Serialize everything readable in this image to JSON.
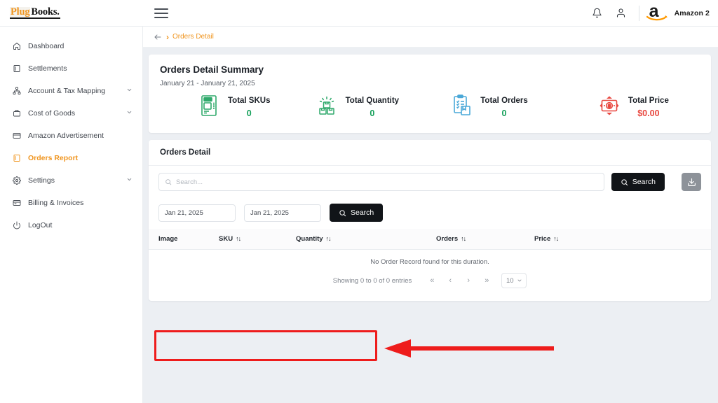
{
  "brand": {
    "logo_plug": "Plug",
    "logo_books": "Books."
  },
  "topbar": {
    "menu_icon": "hamburger-icon",
    "notification_icon": "bell-icon",
    "profile_icon": "user-icon",
    "marketplace_icon": "amazon-logo",
    "marketplace_label": "Amazon 2"
  },
  "sidebar": {
    "items": [
      {
        "label": "Dashboard",
        "icon": "home-icon",
        "active": false,
        "chevron": false
      },
      {
        "label": "Settlements",
        "icon": "book-icon",
        "active": false,
        "chevron": false
      },
      {
        "label": "Account & Tax Mapping",
        "icon": "sitemap-icon",
        "active": false,
        "chevron": true
      },
      {
        "label": "Cost of Goods",
        "icon": "briefcase-icon",
        "active": false,
        "chevron": true
      },
      {
        "label": "Amazon Advertisement",
        "icon": "card-icon",
        "active": false,
        "chevron": false
      },
      {
        "label": "Orders Report",
        "icon": "report-icon",
        "active": true,
        "chevron": false
      },
      {
        "label": "Settings",
        "icon": "gear-icon",
        "active": false,
        "chevron": true
      },
      {
        "label": "Billing & Invoices",
        "icon": "invoice-icon",
        "active": false,
        "chevron": false
      },
      {
        "label": "LogOut",
        "icon": "power-icon",
        "active": false,
        "chevron": false
      }
    ]
  },
  "breadcrumb": {
    "back_icon": "back-arrow-icon",
    "separator": "›",
    "current": "Orders Detail"
  },
  "summary": {
    "title": "Orders Detail Summary",
    "date_range": "January 21 - January 21, 2025",
    "stats": [
      {
        "label": "Total SKUs",
        "value": "0",
        "icon": "sku-document-icon",
        "color": "green"
      },
      {
        "label": "Total Quantity",
        "value": "0",
        "icon": "boxes-stack-icon",
        "color": "green"
      },
      {
        "label": "Total Orders",
        "value": "0",
        "icon": "clipboard-box-icon",
        "color": "green"
      },
      {
        "label": "Total Price",
        "value": "$0.00",
        "icon": "money-bill-icon",
        "color": "red"
      }
    ]
  },
  "orders_panel": {
    "title": "Orders Detail",
    "search_placeholder": "Search...",
    "search_button": "Search",
    "search_icon": "search-icon",
    "download_icon": "download-icon",
    "date_from": "Jan 21, 2025",
    "date_to": "Jan 21, 2025",
    "date_search_button": "Search",
    "columns": [
      {
        "label": "Image",
        "sortable": false
      },
      {
        "label": "SKU",
        "sortable": true
      },
      {
        "label": "Quantity",
        "sortable": true
      },
      {
        "label": "Orders",
        "sortable": true
      },
      {
        "label": "Price",
        "sortable": true
      }
    ],
    "sort_glyph": "↑↓",
    "empty_message": "No Order Record found for this duration.",
    "showing_text": "Showing 0 to 0 of 0 entries",
    "pagination": {
      "first": "«",
      "prev": "‹",
      "next": "›",
      "last": "»"
    },
    "per_page": "10",
    "per_page_chevron": "∨"
  },
  "annotation": {
    "color": "#ee1c1c",
    "shape": "box-and-left-arrow",
    "target": "date-range-search"
  },
  "colors": {
    "accent": "#f0951f",
    "green": "#15a05a",
    "red": "#e8473f",
    "dark": "#111418",
    "bg": "#eceff3"
  }
}
